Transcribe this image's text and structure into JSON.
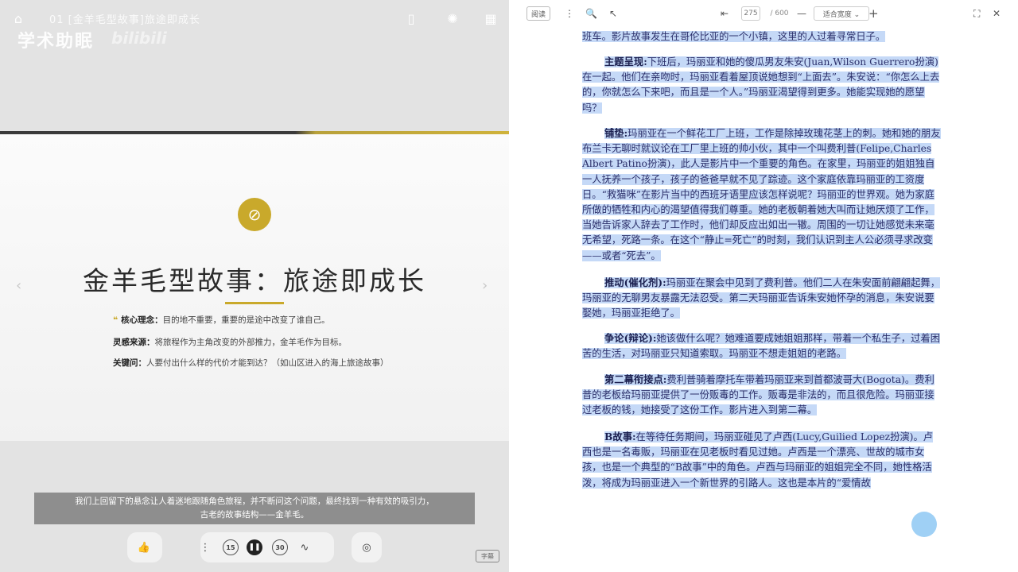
{
  "video": {
    "title": "01 [金羊毛型故事]旅途即成长",
    "watermark": "学术助眠",
    "watermark_logo": "bilibili",
    "slide": {
      "title": "金羊毛型故事：旅途即成长",
      "core_label": "核心理念：",
      "core_text": "目的地不重要，重要的是途中改变了谁自己。",
      "line2_label": "灵感来源：",
      "line2_text": "将旅程作为主角改变的外部推力，金羊毛作为目标。",
      "line3_label": "关键问：",
      "line3_text": "人要付出什么样的代价才能到达？（如山区进入的海上旅途故事）"
    },
    "subtitle_line1": "我们上回留下的悬念让人着迷地跟随角色旅程，并不断问这个问题，最终找到一种有效的吸引力，",
    "subtitle_line2": "古老的故事结构——金羊毛。",
    "controls": {
      "like": "👍",
      "more": "⋮",
      "rewind": "15",
      "pause": "❚❚",
      "forward": "30",
      "wave": "∿",
      "settings": "◎"
    },
    "subtitle_toggle": "字幕"
  },
  "reader": {
    "toolbar": {
      "read_mode": "阅读",
      "more": "⋮",
      "search": "🔍",
      "pointer": "↖",
      "first_page": "⇤",
      "page_number": "275",
      "total_pages": "/ 600",
      "zoom_out": "—",
      "zoom_value": "适合宽度 ⌄",
      "zoom_in": "+",
      "expand": "⛶",
      "close": "✕"
    },
    "paragraphs": [
      {
        "label": "",
        "text": "班车。影片故事发生在哥伦比亚的一个小镇，这里的人过着寻常日子。"
      },
      {
        "label": "主题呈现:",
        "text": "下班后，玛丽亚和她的傻瓜男友朱安(Juan,Wilson Guerrero扮演)在一起。他们在亲吻时，玛丽亚看着屋顶说她想到“上面去”。朱安说：“你怎么上去的，你就怎么下来吧，而且是一个人。”玛丽亚渴望得到更多。她能实现她的愿望吗？"
      },
      {
        "label": "铺垫:",
        "text": "玛丽亚在一个鲜花工厂上班，工作是除掉玫瑰花茎上的刺。她和她的朋友布兰卡无聊时就议论在工厂里上班的帅小伙，其中一个叫费利普(Felipe,Charles Albert Patino扮演)，此人是影片中一个重要的角色。在家里，玛丽亚的姐姐独自一人抚养一个孩子，孩子的爸爸早就不见了踪迹。这个家庭依靠玛丽亚的工资度日。“救猫咪”在影片当中的西班牙语里应该怎样说呢？玛丽亚的世界观。她为家庭所做的牺牲和内心的渴望值得我们尊重。她的老板朝着她大叫而让她厌烦了工作，当她告诉家人辞去了工作时，他们却反应出如出一辙。周围的一切让她感觉未来毫无希望，死路一条。在这个“静止=死亡”的时刻，我们认识到主人公必须寻求改变——或者“死去”。"
      },
      {
        "label": "推动(催化剂):",
        "text": "玛丽亚在聚会中见到了费利普。他们二人在朱安面前翩翩起舞，玛丽亚的无聊男友暴露无法忍受。第二天玛丽亚告诉朱安她怀孕的消息，朱安说要娶她，玛丽亚拒绝了。"
      },
      {
        "label": "争论(辩论):",
        "text": "她该做什么呢？她难道要成她姐姐那样，带着一个私生子，过着困苦的生活，对玛丽亚只知道索取。玛丽亚不想走姐姐的老路。"
      },
      {
        "label": "第二幕衔接点:",
        "text": "费利普骑着摩托车带着玛丽亚来到首都波哥大(Bogota)。费利普的老板给玛丽亚提供了一份贩毒的工作。贩毒是非法的，而且很危险。玛丽亚接过老板的钱，她接受了这份工作。影片进入到第二幕。"
      },
      {
        "label": "B故事:",
        "text": "在等待任务期间，玛丽亚碰见了卢西(Lucy,Guilied Lopez扮演)。卢西也是一名毒贩，玛丽亚在见老板时看见过她。卢西是一个漂亮、世故的城市女孩，也是一个典型的“B故事”中的角色。卢西与玛丽亚的姐姐完全不同，她性格活泼，将成为玛丽亚进入一个新世界的引路人。这也是本片的“爱情故"
      }
    ]
  }
}
